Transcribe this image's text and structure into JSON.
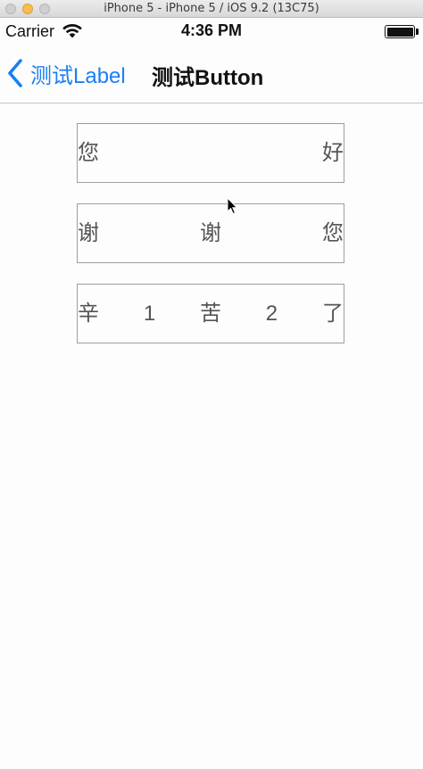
{
  "window": {
    "title": "iPhone 5 - iPhone 5 / iOS 9.2 (13C75)"
  },
  "status_bar": {
    "carrier": "Carrier",
    "time": "4:36 PM",
    "wifi_icon": "wifi-icon",
    "battery_icon": "battery-full-icon"
  },
  "nav_bar": {
    "back_label": "测试Label",
    "back_icon": "chevron-left-icon",
    "title": "测试Button",
    "accent_color": "#1a7ff4"
  },
  "buttons": [
    {
      "chars": [
        "您",
        "好"
      ]
    },
    {
      "chars": [
        "谢",
        "谢",
        "您"
      ]
    },
    {
      "chars": [
        "辛",
        "1",
        "苦",
        "2",
        "了"
      ]
    }
  ]
}
